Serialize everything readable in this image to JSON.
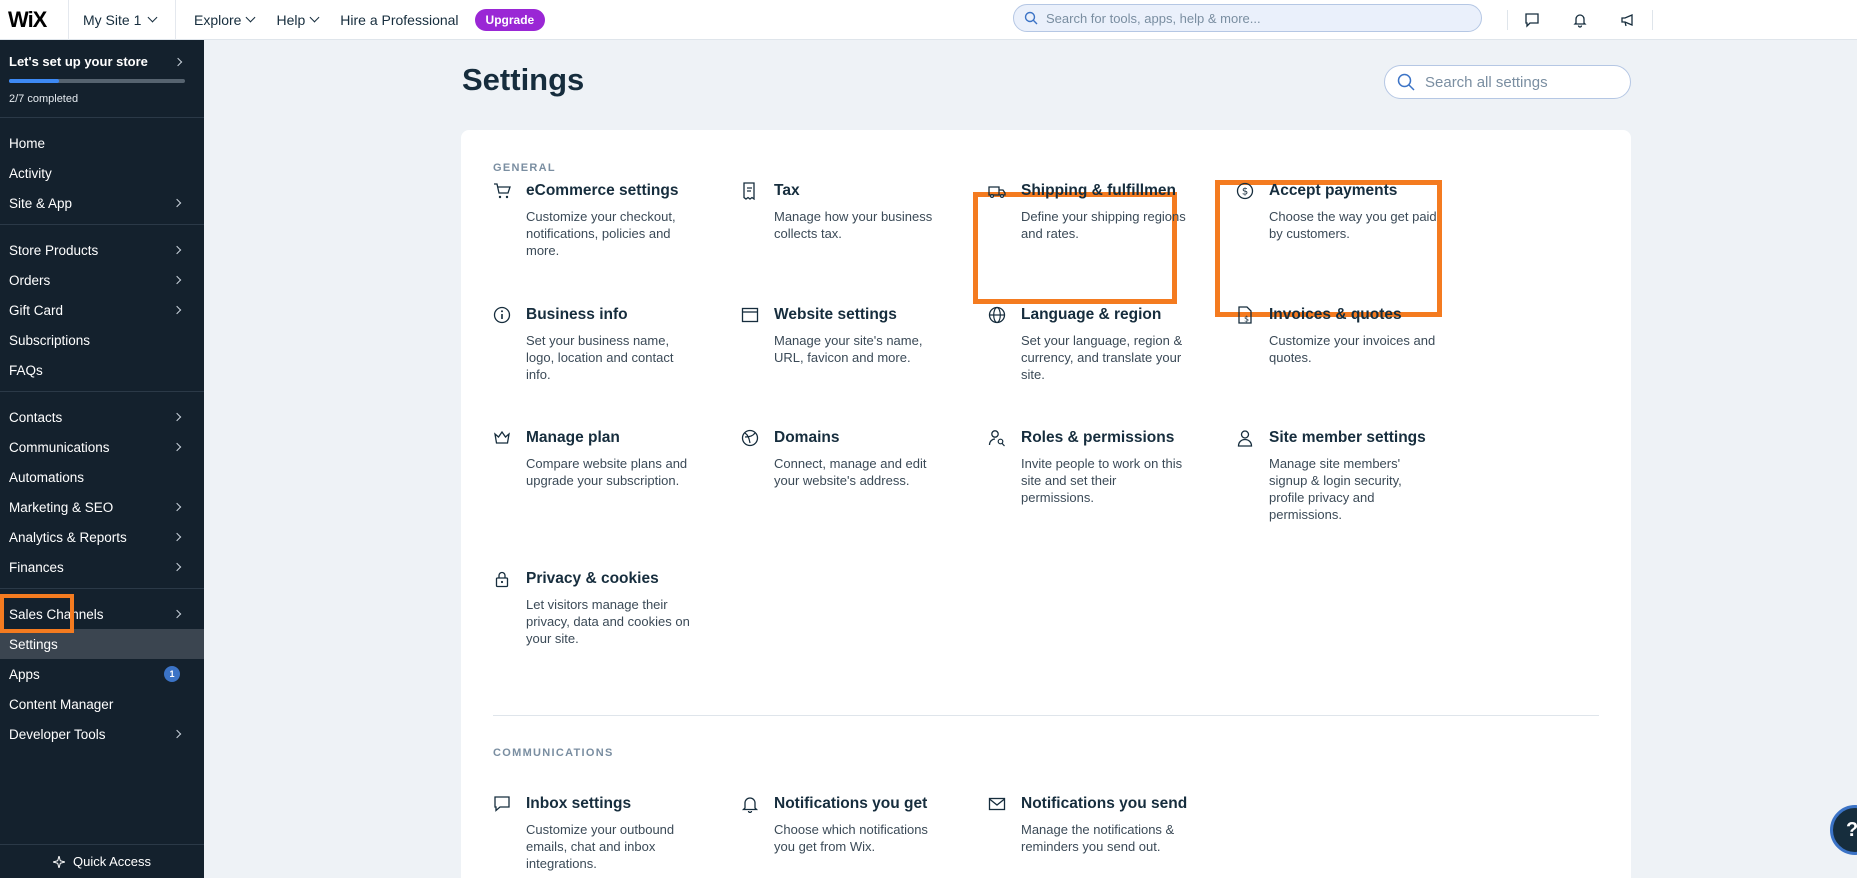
{
  "topbar": {
    "logo": "WiX",
    "site_name": "My Site 1",
    "nav": [
      {
        "label": "Explore",
        "dropdown": true
      },
      {
        "label": "Help",
        "dropdown": true
      },
      {
        "label": "Hire a Professional",
        "dropdown": false
      }
    ],
    "upgrade_label": "Upgrade",
    "search_placeholder": "Search for tools, apps, help & more...",
    "icons": [
      "chat-icon",
      "bell-icon",
      "megaphone-icon"
    ]
  },
  "sidebar": {
    "setup_title": "Let's set up your store",
    "setup_progress": 0.2857,
    "setup_count": "2/7 completed",
    "groups": [
      [
        {
          "label": "Home",
          "chevron": false
        },
        {
          "label": "Activity",
          "chevron": false
        },
        {
          "label": "Site & App",
          "chevron": true
        }
      ],
      [
        {
          "label": "Store Products",
          "chevron": true
        },
        {
          "label": "Orders",
          "chevron": true
        },
        {
          "label": "Gift Card",
          "chevron": true
        },
        {
          "label": "Subscriptions",
          "chevron": false
        },
        {
          "label": "FAQs",
          "chevron": false
        }
      ],
      [
        {
          "label": "Contacts",
          "chevron": true
        },
        {
          "label": "Communications",
          "chevron": true
        },
        {
          "label": "Automations",
          "chevron": false
        },
        {
          "label": "Marketing & SEO",
          "chevron": true
        },
        {
          "label": "Analytics & Reports",
          "chevron": true
        },
        {
          "label": "Finances",
          "chevron": true
        }
      ],
      [
        {
          "label": "Sales Channels",
          "chevron": true
        },
        {
          "label": "Settings",
          "chevron": false,
          "active": true
        },
        {
          "label": "Apps",
          "chevron": false,
          "badge": "1"
        },
        {
          "label": "Content Manager",
          "chevron": false
        },
        {
          "label": "Developer Tools",
          "chevron": true
        }
      ]
    ],
    "quick_access": "Quick Access"
  },
  "main": {
    "title": "Settings",
    "search_placeholder": "Search all settings",
    "sections": [
      {
        "label": "GENERAL",
        "tiles": [
          {
            "icon": "cart-icon",
            "title": "eCommerce settings",
            "desc": "Customize your checkout, notifications, policies and more."
          },
          {
            "icon": "tax-receipt-icon",
            "title": "Tax",
            "desc": "Manage how your business collects tax."
          },
          {
            "icon": "truck-icon",
            "title": "Shipping & fulfillment",
            "desc": "Define your shipping regions and rates."
          },
          {
            "icon": "dollar-icon",
            "title": "Accept payments",
            "desc": "Choose the way you get paid by customers."
          },
          {
            "icon": "info-icon",
            "title": "Business info",
            "desc": "Set your business name, logo, location and contact info."
          },
          {
            "icon": "browser-icon",
            "title": "Website settings",
            "desc": "Manage your site's name, URL, favicon and more."
          },
          {
            "icon": "globe-icon",
            "title": "Language & region",
            "desc": "Set your language, region & currency, and translate your site."
          },
          {
            "icon": "invoice-icon",
            "title": "Invoices & quotes",
            "desc": "Customize your invoices and quotes."
          },
          {
            "icon": "crown-icon",
            "title": "Manage plan",
            "desc": "Compare website plans and upgrade your subscription."
          },
          {
            "icon": "domain-icon",
            "title": "Domains",
            "desc": "Connect, manage and edit your website's address."
          },
          {
            "icon": "user-key-icon",
            "title": "Roles & permissions",
            "desc": "Invite people to work on this site and set their permissions."
          },
          {
            "icon": "member-icon",
            "title": "Site member settings",
            "desc": "Manage site members' signup & login security, profile privacy and permissions."
          },
          {
            "icon": "lock-icon",
            "title": "Privacy & cookies",
            "desc": "Let visitors manage their privacy, data and cookies on your site."
          }
        ]
      },
      {
        "label": "COMMUNICATIONS",
        "tiles": [
          {
            "icon": "inbox-icon",
            "title": "Inbox settings",
            "desc": "Customize your outbound emails, chat and inbox integrations."
          },
          {
            "icon": "bell-icon",
            "title": "Notifications you get",
            "desc": "Choose which notifications you get from Wix."
          },
          {
            "icon": "envelope-icon",
            "title": "Notifications you send",
            "desc": "Manage the notifications & reminders you send out."
          }
        ]
      }
    ]
  },
  "colors": {
    "highlight": "#f47b20",
    "upgrade": "#9a27d5",
    "sidebar_bg": "#14212d",
    "accent": "#3d89f4"
  }
}
